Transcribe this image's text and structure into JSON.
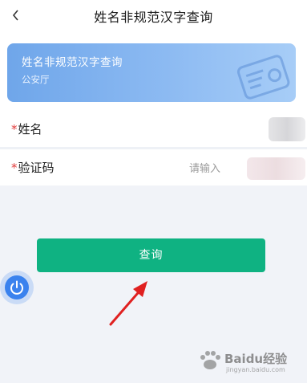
{
  "header": {
    "title": "姓名非规范汉字查询",
    "back_icon": "chevron-left-icon"
  },
  "hero": {
    "title": "姓名非规范汉字查询",
    "subtitle": "公安厅",
    "icon": "id-card-icon",
    "gradient": [
      "#6fa6ea",
      "#a7cdf7"
    ]
  },
  "form": {
    "name_field": {
      "required_mark": "*",
      "label": "姓名"
    },
    "code_field": {
      "required_mark": "*",
      "label": "验证码",
      "placeholder": "请输入"
    }
  },
  "actions": {
    "query_label": "查询",
    "query_color": "#0fb282"
  },
  "floating": {
    "power_icon": "power-icon",
    "color": "#3a82ee"
  },
  "annotation": {
    "arrow_color": "#e02020"
  },
  "watermark": {
    "logo_text": "Baidu经验",
    "sub_text": "jingyan.baidu.com"
  }
}
